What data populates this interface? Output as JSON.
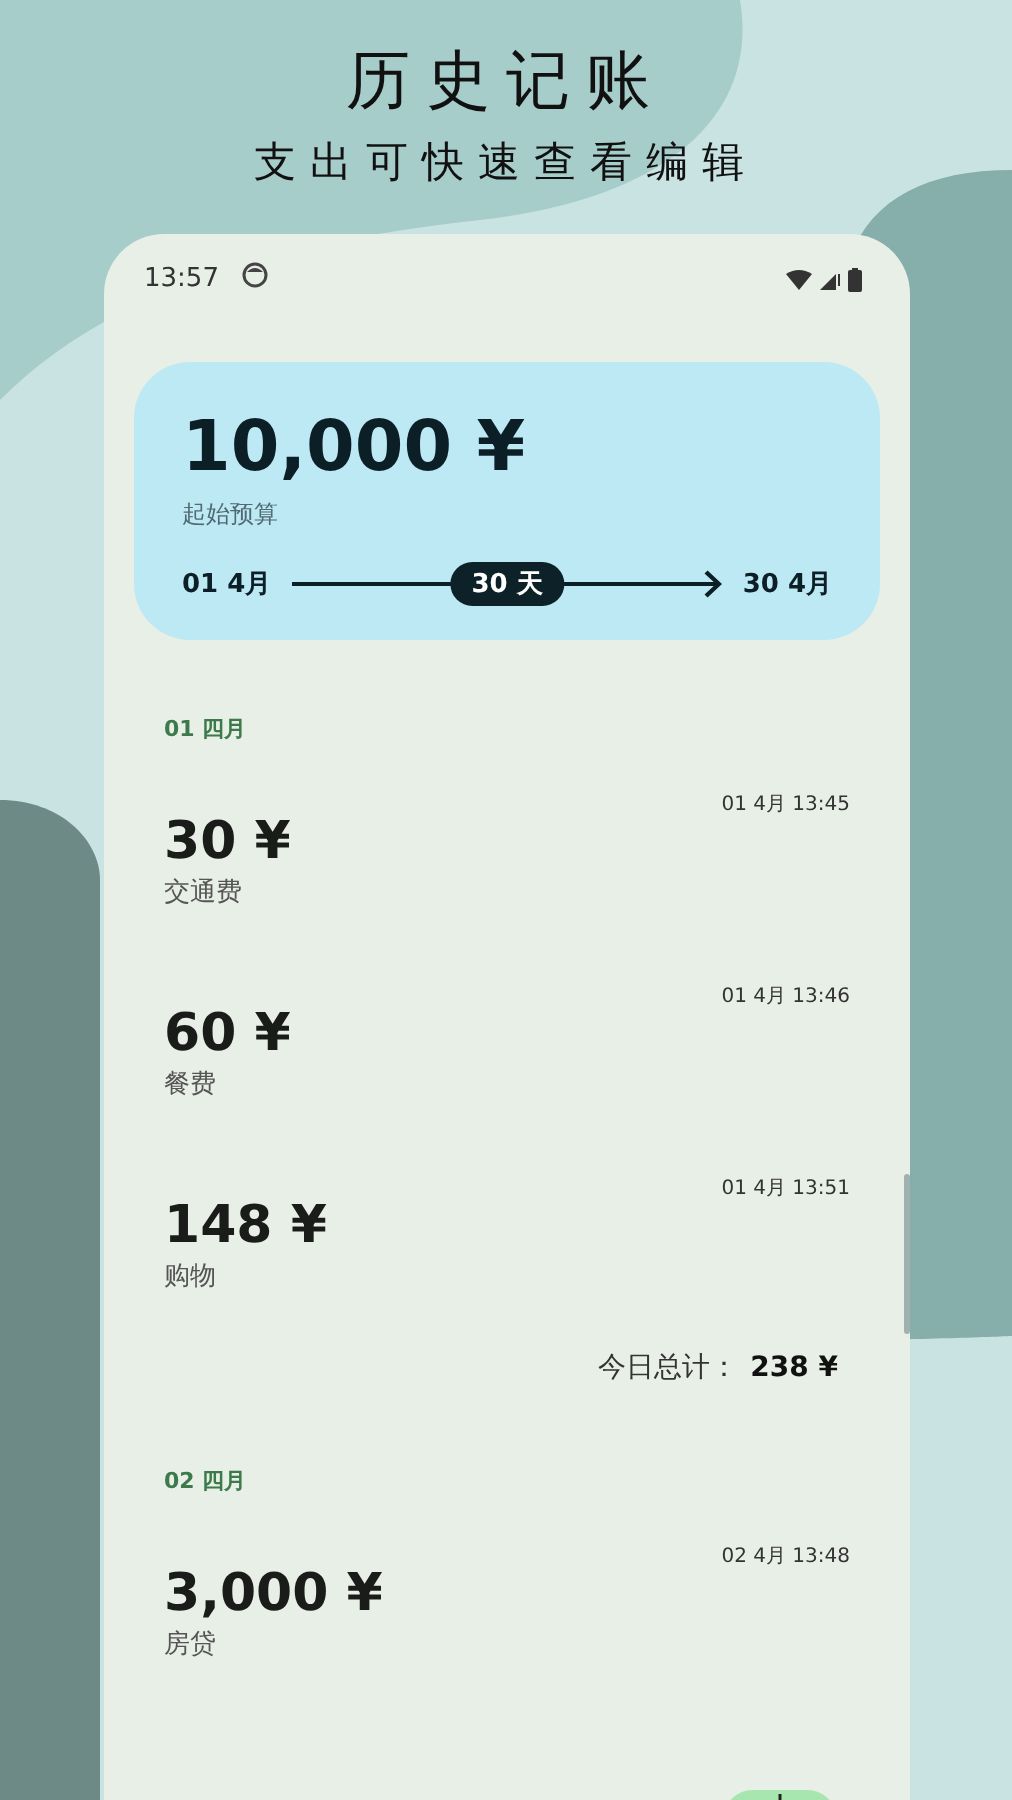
{
  "promo": {
    "title": "历史记账",
    "subtitle": "支出可快速查看编辑"
  },
  "status_bar": {
    "time": "13:57"
  },
  "budget": {
    "amount": "10,000 ¥",
    "label": "起始预算",
    "start": "01 4月",
    "duration": "30 天",
    "end": "30 4月"
  },
  "groups": [
    {
      "header": "01 四月",
      "entries": [
        {
          "amount": "30 ¥",
          "category": "交通费",
          "time": "01 4月 13:45"
        },
        {
          "amount": "60 ¥",
          "category": "餐费",
          "time": "01 4月 13:46"
        },
        {
          "amount": "148 ¥",
          "category": "购物",
          "time": "01 4月 13:51"
        }
      ],
      "total_label": "今日总计：",
      "total": "238 ¥"
    },
    {
      "header": "02 四月",
      "entries": [
        {
          "amount": "3,000 ¥",
          "category": "房贷",
          "time": "02 4月 13:48"
        }
      ]
    }
  ]
}
